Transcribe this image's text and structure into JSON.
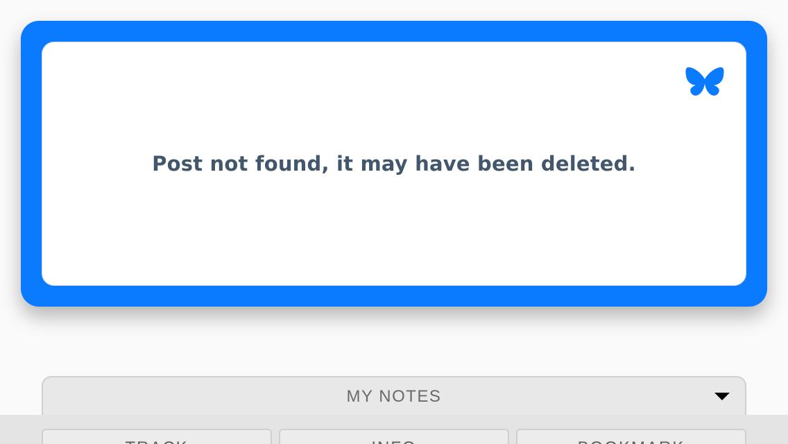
{
  "embed": {
    "message": "Post not found, it may have been deleted.",
    "icon": "butterfly-icon",
    "accent_color": "#0a7aff"
  },
  "notes": {
    "label": "MY NOTES",
    "toggle_icon": "caret-down-icon"
  },
  "tabs": [
    {
      "label": "TRACK"
    },
    {
      "label": "INFO"
    },
    {
      "label": "BOOKMARK"
    }
  ]
}
